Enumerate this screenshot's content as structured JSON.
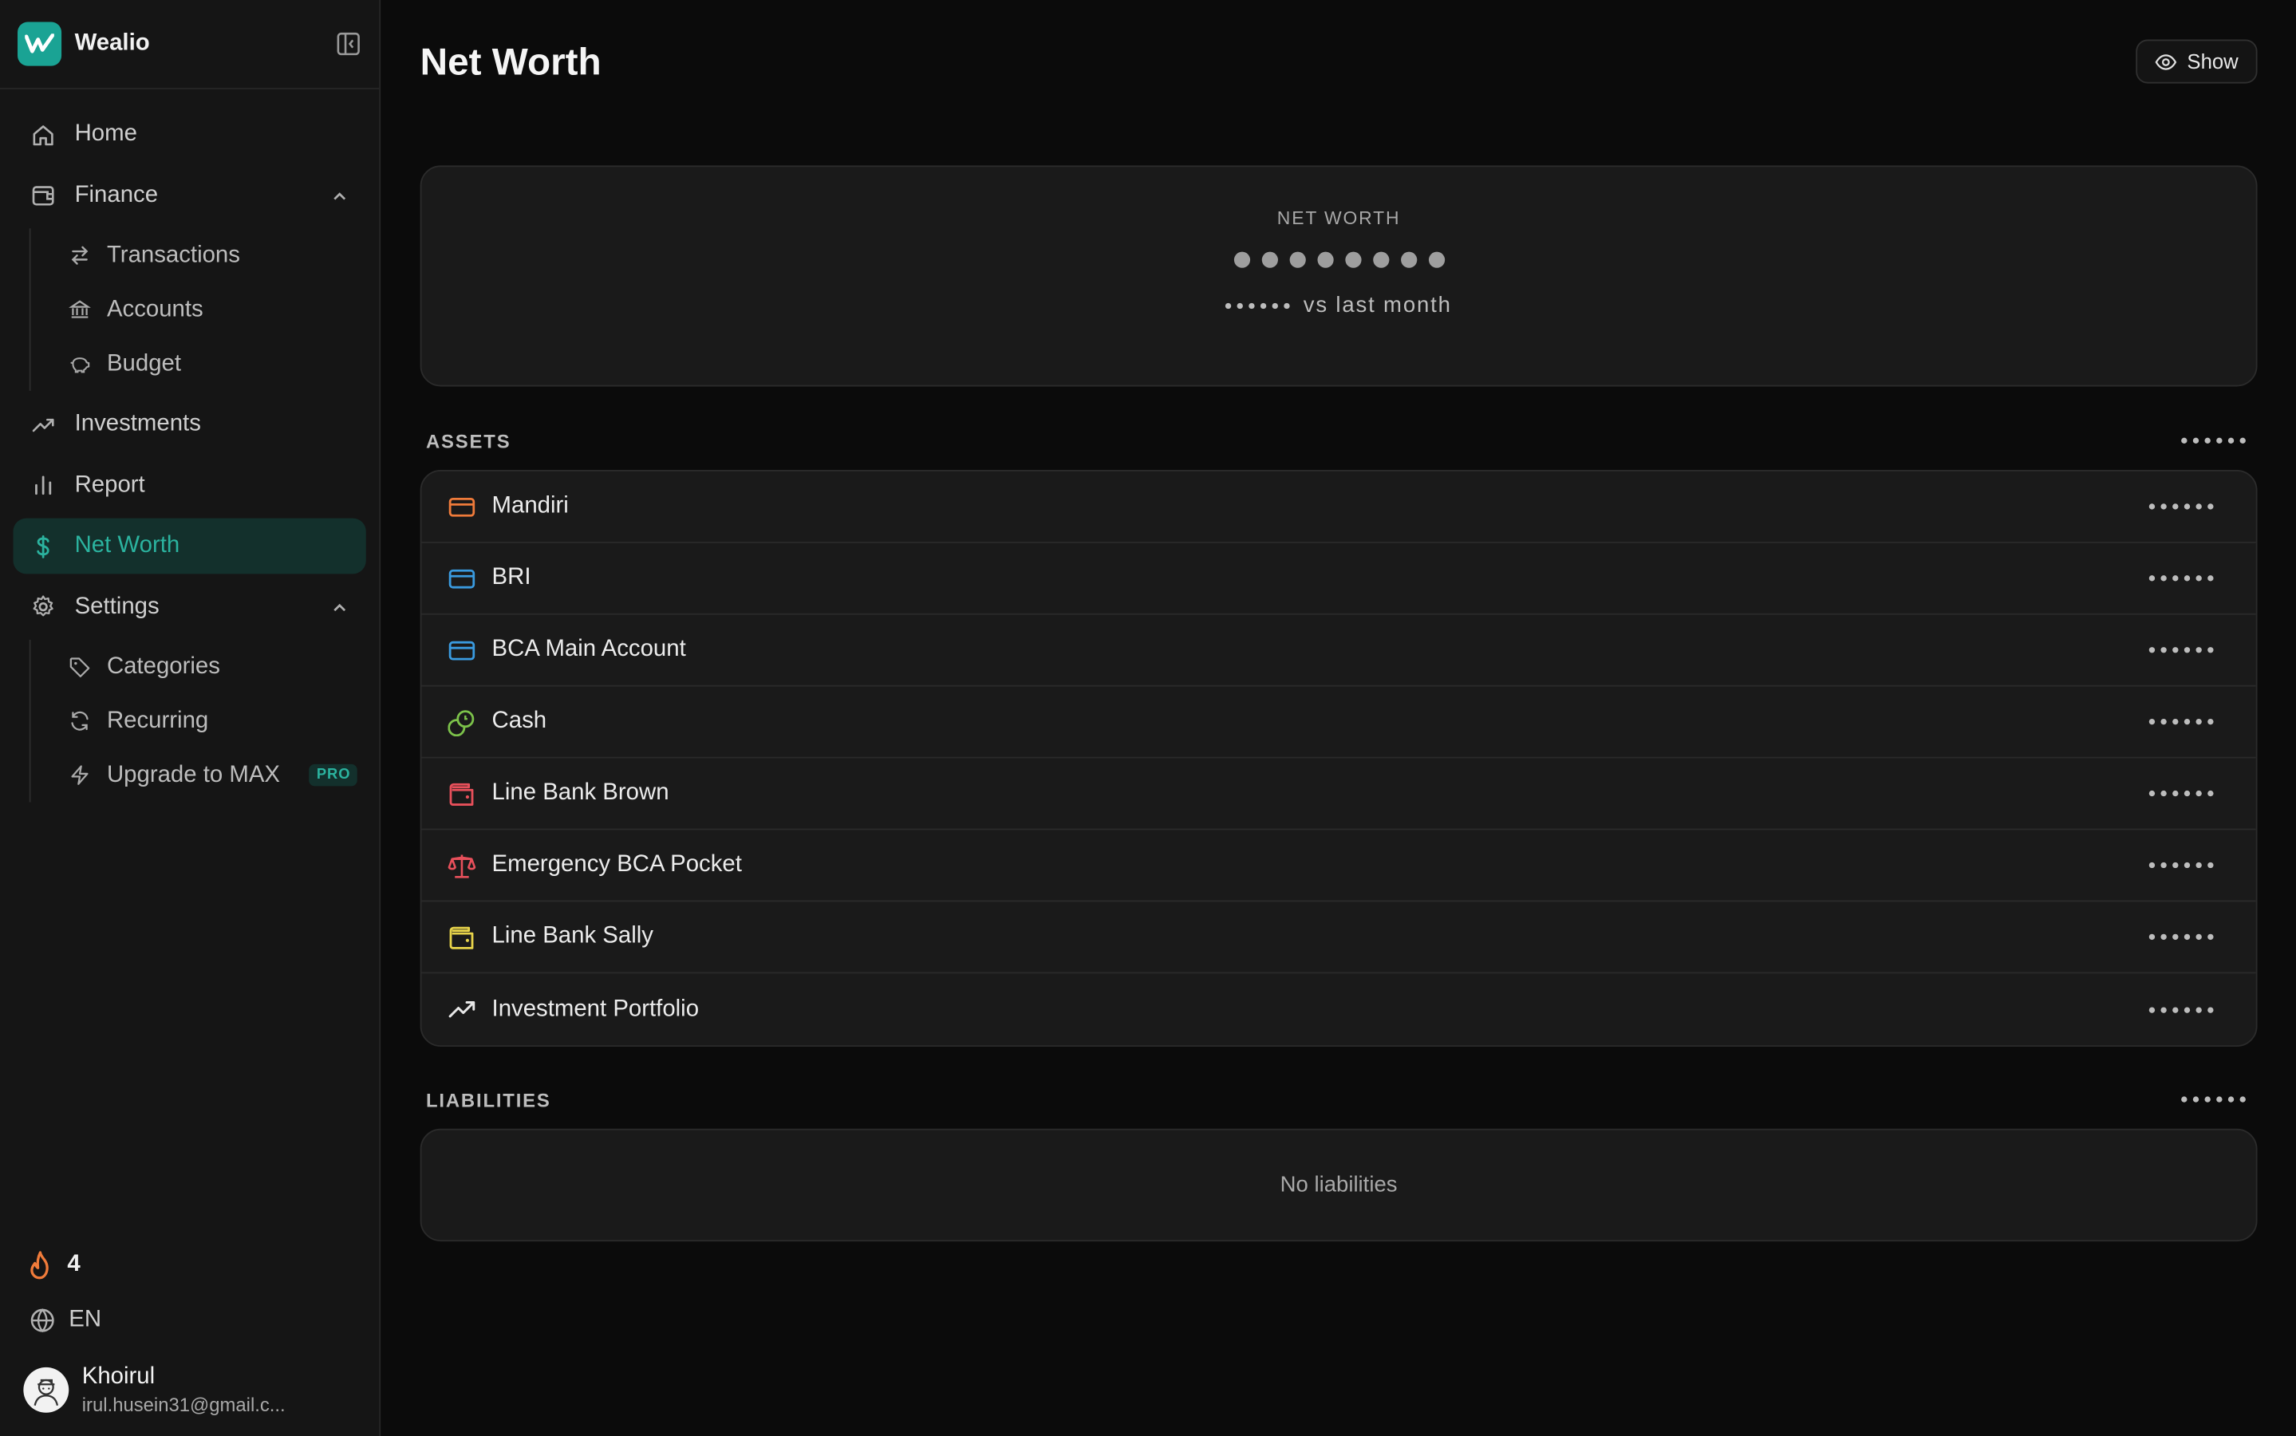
{
  "app": {
    "name": "Wealio"
  },
  "sidebar": {
    "nav": {
      "home": "Home",
      "finance": "Finance",
      "finance_sub": {
        "transactions": "Transactions",
        "accounts": "Accounts",
        "budget": "Budget"
      },
      "investments": "Investments",
      "report": "Report",
      "net_worth": "Net Worth",
      "settings": "Settings",
      "settings_sub": {
        "categories": "Categories",
        "recurring": "Recurring",
        "upgrade": "Upgrade to MAX",
        "pro_badge": "PRO"
      }
    },
    "streak_count": "4",
    "language": "EN",
    "user": {
      "name": "Khoirul",
      "email": "irul.husein31@gmail.c..."
    }
  },
  "header": {
    "title": "Net Worth",
    "show_label": "Show"
  },
  "summary": {
    "label": "NET WORTH",
    "comparison_label": "vs last month"
  },
  "assets": {
    "title": "ASSETS",
    "items": [
      {
        "name": "Mandiri",
        "icon": "credit-card-icon",
        "color": "#f07b3a"
      },
      {
        "name": "BRI",
        "icon": "credit-card-icon",
        "color": "#3a9be0"
      },
      {
        "name": "BCA Main Account",
        "icon": "credit-card-icon",
        "color": "#3a9be0"
      },
      {
        "name": "Cash",
        "icon": "coins-icon",
        "color": "#7cc24a"
      },
      {
        "name": "Line Bank Brown",
        "icon": "wallet-icon",
        "color": "#e8505b"
      },
      {
        "name": "Emergency BCA Pocket",
        "icon": "scale-icon",
        "color": "#e8505b"
      },
      {
        "name": "Line Bank Sally",
        "icon": "wallet-icon",
        "color": "#e8d44a"
      },
      {
        "name": "Investment Portfolio",
        "icon": "trending-up-icon",
        "color": "#e8e8e8"
      }
    ]
  },
  "liabilities": {
    "title": "LIABILITIES",
    "empty_text": "No liabilities"
  },
  "colors": {
    "accent": "#2bb39f",
    "background": "#0b0b0b",
    "card": "#1a1a1a"
  }
}
